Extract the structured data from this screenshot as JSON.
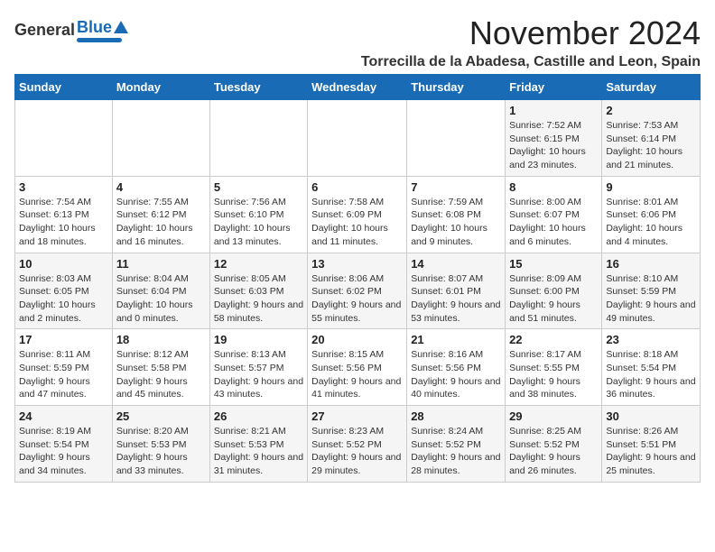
{
  "header": {
    "logo_general": "General",
    "logo_blue": "Blue",
    "month_title": "November 2024",
    "subtitle": "Torrecilla de la Abadesa, Castille and Leon, Spain"
  },
  "weekdays": [
    "Sunday",
    "Monday",
    "Tuesday",
    "Wednesday",
    "Thursday",
    "Friday",
    "Saturday"
  ],
  "weeks": [
    [
      {
        "day": "",
        "info": ""
      },
      {
        "day": "",
        "info": ""
      },
      {
        "day": "",
        "info": ""
      },
      {
        "day": "",
        "info": ""
      },
      {
        "day": "",
        "info": ""
      },
      {
        "day": "1",
        "info": "Sunrise: 7:52 AM\nSunset: 6:15 PM\nDaylight: 10 hours and 23 minutes."
      },
      {
        "day": "2",
        "info": "Sunrise: 7:53 AM\nSunset: 6:14 PM\nDaylight: 10 hours and 21 minutes."
      }
    ],
    [
      {
        "day": "3",
        "info": "Sunrise: 7:54 AM\nSunset: 6:13 PM\nDaylight: 10 hours and 18 minutes."
      },
      {
        "day": "4",
        "info": "Sunrise: 7:55 AM\nSunset: 6:12 PM\nDaylight: 10 hours and 16 minutes."
      },
      {
        "day": "5",
        "info": "Sunrise: 7:56 AM\nSunset: 6:10 PM\nDaylight: 10 hours and 13 minutes."
      },
      {
        "day": "6",
        "info": "Sunrise: 7:58 AM\nSunset: 6:09 PM\nDaylight: 10 hours and 11 minutes."
      },
      {
        "day": "7",
        "info": "Sunrise: 7:59 AM\nSunset: 6:08 PM\nDaylight: 10 hours and 9 minutes."
      },
      {
        "day": "8",
        "info": "Sunrise: 8:00 AM\nSunset: 6:07 PM\nDaylight: 10 hours and 6 minutes."
      },
      {
        "day": "9",
        "info": "Sunrise: 8:01 AM\nSunset: 6:06 PM\nDaylight: 10 hours and 4 minutes."
      }
    ],
    [
      {
        "day": "10",
        "info": "Sunrise: 8:03 AM\nSunset: 6:05 PM\nDaylight: 10 hours and 2 minutes."
      },
      {
        "day": "11",
        "info": "Sunrise: 8:04 AM\nSunset: 6:04 PM\nDaylight: 10 hours and 0 minutes."
      },
      {
        "day": "12",
        "info": "Sunrise: 8:05 AM\nSunset: 6:03 PM\nDaylight: 9 hours and 58 minutes."
      },
      {
        "day": "13",
        "info": "Sunrise: 8:06 AM\nSunset: 6:02 PM\nDaylight: 9 hours and 55 minutes."
      },
      {
        "day": "14",
        "info": "Sunrise: 8:07 AM\nSunset: 6:01 PM\nDaylight: 9 hours and 53 minutes."
      },
      {
        "day": "15",
        "info": "Sunrise: 8:09 AM\nSunset: 6:00 PM\nDaylight: 9 hours and 51 minutes."
      },
      {
        "day": "16",
        "info": "Sunrise: 8:10 AM\nSunset: 5:59 PM\nDaylight: 9 hours and 49 minutes."
      }
    ],
    [
      {
        "day": "17",
        "info": "Sunrise: 8:11 AM\nSunset: 5:59 PM\nDaylight: 9 hours and 47 minutes."
      },
      {
        "day": "18",
        "info": "Sunrise: 8:12 AM\nSunset: 5:58 PM\nDaylight: 9 hours and 45 minutes."
      },
      {
        "day": "19",
        "info": "Sunrise: 8:13 AM\nSunset: 5:57 PM\nDaylight: 9 hours and 43 minutes."
      },
      {
        "day": "20",
        "info": "Sunrise: 8:15 AM\nSunset: 5:56 PM\nDaylight: 9 hours and 41 minutes."
      },
      {
        "day": "21",
        "info": "Sunrise: 8:16 AM\nSunset: 5:56 PM\nDaylight: 9 hours and 40 minutes."
      },
      {
        "day": "22",
        "info": "Sunrise: 8:17 AM\nSunset: 5:55 PM\nDaylight: 9 hours and 38 minutes."
      },
      {
        "day": "23",
        "info": "Sunrise: 8:18 AM\nSunset: 5:54 PM\nDaylight: 9 hours and 36 minutes."
      }
    ],
    [
      {
        "day": "24",
        "info": "Sunrise: 8:19 AM\nSunset: 5:54 PM\nDaylight: 9 hours and 34 minutes."
      },
      {
        "day": "25",
        "info": "Sunrise: 8:20 AM\nSunset: 5:53 PM\nDaylight: 9 hours and 33 minutes."
      },
      {
        "day": "26",
        "info": "Sunrise: 8:21 AM\nSunset: 5:53 PM\nDaylight: 9 hours and 31 minutes."
      },
      {
        "day": "27",
        "info": "Sunrise: 8:23 AM\nSunset: 5:52 PM\nDaylight: 9 hours and 29 minutes."
      },
      {
        "day": "28",
        "info": "Sunrise: 8:24 AM\nSunset: 5:52 PM\nDaylight: 9 hours and 28 minutes."
      },
      {
        "day": "29",
        "info": "Sunrise: 8:25 AM\nSunset: 5:52 PM\nDaylight: 9 hours and 26 minutes."
      },
      {
        "day": "30",
        "info": "Sunrise: 8:26 AM\nSunset: 5:51 PM\nDaylight: 9 hours and 25 minutes."
      }
    ]
  ]
}
